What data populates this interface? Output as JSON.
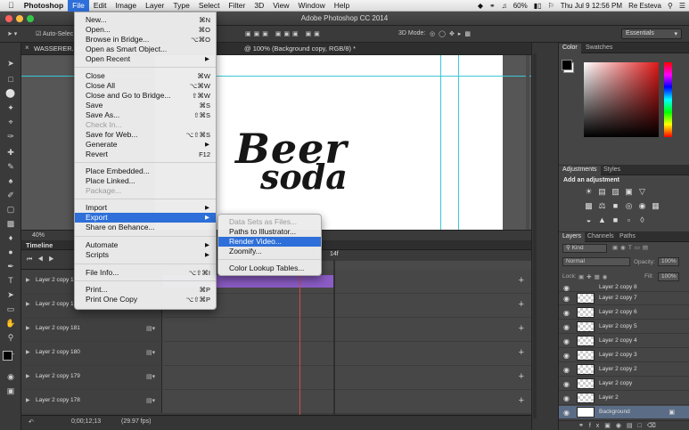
{
  "menubar": {
    "apple": "",
    "app": "Photoshop",
    "items": [
      "File",
      "Edit",
      "Image",
      "Layer",
      "Type",
      "Select",
      "Filter",
      "3D",
      "View",
      "Window",
      "Help"
    ],
    "battery": "60%",
    "datetime": "Thu Jul 9  12:56 PM",
    "user": "Re Esteva"
  },
  "window": {
    "title": "Adobe Photoshop CC 2014"
  },
  "options": {
    "auto_select": "Auto-Selec",
    "mode_3d": "3D Mode:",
    "workspace": "Essentials"
  },
  "document": {
    "tab_name": "WASSERER.psd",
    "tab_detail": "@ 100% (Background copy, RGB/8) *",
    "zoom": "40%",
    "logo_line1": "Beer",
    "logo_line2": "soda"
  },
  "timeline": {
    "title": "Timeline",
    "frame_marker": "14f",
    "timecode": "0;00;12;13",
    "fps": "(29.97 fps)",
    "tracks": [
      "Layer 2 copy 183",
      "Layer 2 copy 182",
      "Layer 2 copy 181",
      "Layer 2 copy 180",
      "Layer 2 copy 179",
      "Layer 2 copy 178"
    ]
  },
  "color_panel": {
    "tabs": [
      "Color",
      "Swatches"
    ]
  },
  "adjustments_panel": {
    "tabs": [
      "Adjustments",
      "Styles"
    ],
    "add_label": "Add an adjustment"
  },
  "layers_panel": {
    "tabs": [
      "Layers",
      "Channels",
      "Paths"
    ],
    "filter": "Kind",
    "blend_mode": "Normal",
    "opacity_label": "Opacity:",
    "opacity": "100%",
    "lock_label": "Lock:",
    "fill_label": "Fill:",
    "fill": "100%",
    "layers": [
      "Layer 2 copy 8",
      "Layer 2 copy 7",
      "Layer 2 copy 6",
      "Layer 2 copy 5",
      "Layer 2 copy 4",
      "Layer 2 copy 3",
      "Layer 2 copy 2",
      "Layer 2 copy",
      "Layer 2",
      "Background"
    ]
  },
  "file_menu": {
    "items": [
      {
        "label": "New...",
        "shortcut": "⌘N"
      },
      {
        "label": "Open...",
        "shortcut": "⌘O"
      },
      {
        "label": "Browse in Bridge...",
        "shortcut": "⌥⌘O"
      },
      {
        "label": "Open as Smart Object...",
        "shortcut": ""
      },
      {
        "label": "Open Recent",
        "shortcut": "▶"
      },
      {
        "label": "Close",
        "shortcut": "⌘W"
      },
      {
        "label": "Close All",
        "shortcut": "⌥⌘W"
      },
      {
        "label": "Close and Go to Bridge...",
        "shortcut": "⇧⌘W"
      },
      {
        "label": "Save",
        "shortcut": "⌘S"
      },
      {
        "label": "Save As...",
        "shortcut": "⇧⌘S"
      },
      {
        "label": "Check In...",
        "shortcut": ""
      },
      {
        "label": "Save for Web...",
        "shortcut": "⌥⇧⌘S"
      },
      {
        "label": "Generate",
        "shortcut": "▶"
      },
      {
        "label": "Revert",
        "shortcut": "F12"
      },
      {
        "label": "Place Embedded...",
        "shortcut": ""
      },
      {
        "label": "Place Linked...",
        "shortcut": ""
      },
      {
        "label": "Package...",
        "shortcut": ""
      },
      {
        "label": "Import",
        "shortcut": "▶"
      },
      {
        "label": "Export",
        "shortcut": "▶"
      },
      {
        "label": "Share on Behance...",
        "shortcut": ""
      },
      {
        "label": "Automate",
        "shortcut": "▶"
      },
      {
        "label": "Scripts",
        "shortcut": "▶"
      },
      {
        "label": "File Info...",
        "shortcut": "⌥⇧⌘I"
      },
      {
        "label": "Print...",
        "shortcut": "⌘P"
      },
      {
        "label": "Print One Copy",
        "shortcut": "⌥⇧⌘P"
      }
    ]
  },
  "export_menu": {
    "items": [
      "Data Sets as Files...",
      "Paths to Illustrator...",
      "Render Video...",
      "Zoomify...",
      "Color Lookup Tables..."
    ]
  },
  "colors": {
    "accent": "#2e6fd9",
    "clip": "#8b5cc5",
    "guide": "#39c8d8",
    "playhead": "#d24a4a"
  },
  "icons": [
    "apple-icon",
    "wifi-icon",
    "battery-icon",
    "magnifier-icon",
    "list-icon",
    "eye-icon",
    "lock-icon",
    "plus-icon",
    "film-icon",
    "chevron-right-icon"
  ]
}
